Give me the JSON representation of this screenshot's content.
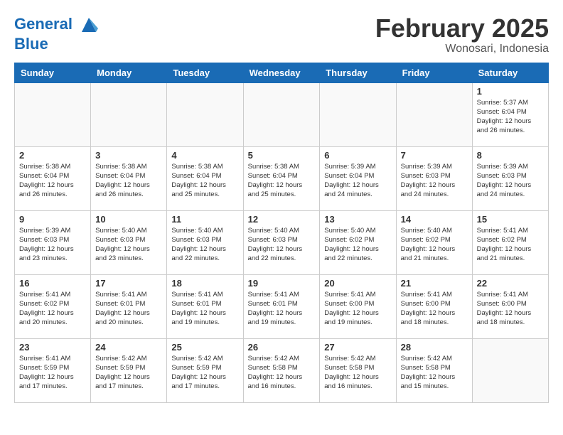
{
  "header": {
    "logo_line1": "General",
    "logo_line2": "Blue",
    "month_title": "February 2025",
    "subtitle": "Wonosari, Indonesia"
  },
  "days_of_week": [
    "Sunday",
    "Monday",
    "Tuesday",
    "Wednesday",
    "Thursday",
    "Friday",
    "Saturday"
  ],
  "weeks": [
    [
      {
        "day": "",
        "info": ""
      },
      {
        "day": "",
        "info": ""
      },
      {
        "day": "",
        "info": ""
      },
      {
        "day": "",
        "info": ""
      },
      {
        "day": "",
        "info": ""
      },
      {
        "day": "",
        "info": ""
      },
      {
        "day": "1",
        "info": "Sunrise: 5:37 AM\nSunset: 6:04 PM\nDaylight: 12 hours\nand 26 minutes."
      }
    ],
    [
      {
        "day": "2",
        "info": "Sunrise: 5:38 AM\nSunset: 6:04 PM\nDaylight: 12 hours\nand 26 minutes."
      },
      {
        "day": "3",
        "info": "Sunrise: 5:38 AM\nSunset: 6:04 PM\nDaylight: 12 hours\nand 26 minutes."
      },
      {
        "day": "4",
        "info": "Sunrise: 5:38 AM\nSunset: 6:04 PM\nDaylight: 12 hours\nand 25 minutes."
      },
      {
        "day": "5",
        "info": "Sunrise: 5:38 AM\nSunset: 6:04 PM\nDaylight: 12 hours\nand 25 minutes."
      },
      {
        "day": "6",
        "info": "Sunrise: 5:39 AM\nSunset: 6:04 PM\nDaylight: 12 hours\nand 24 minutes."
      },
      {
        "day": "7",
        "info": "Sunrise: 5:39 AM\nSunset: 6:03 PM\nDaylight: 12 hours\nand 24 minutes."
      },
      {
        "day": "8",
        "info": "Sunrise: 5:39 AM\nSunset: 6:03 PM\nDaylight: 12 hours\nand 24 minutes."
      }
    ],
    [
      {
        "day": "9",
        "info": "Sunrise: 5:39 AM\nSunset: 6:03 PM\nDaylight: 12 hours\nand 23 minutes."
      },
      {
        "day": "10",
        "info": "Sunrise: 5:40 AM\nSunset: 6:03 PM\nDaylight: 12 hours\nand 23 minutes."
      },
      {
        "day": "11",
        "info": "Sunrise: 5:40 AM\nSunset: 6:03 PM\nDaylight: 12 hours\nand 22 minutes."
      },
      {
        "day": "12",
        "info": "Sunrise: 5:40 AM\nSunset: 6:03 PM\nDaylight: 12 hours\nand 22 minutes."
      },
      {
        "day": "13",
        "info": "Sunrise: 5:40 AM\nSunset: 6:02 PM\nDaylight: 12 hours\nand 22 minutes."
      },
      {
        "day": "14",
        "info": "Sunrise: 5:40 AM\nSunset: 6:02 PM\nDaylight: 12 hours\nand 21 minutes."
      },
      {
        "day": "15",
        "info": "Sunrise: 5:41 AM\nSunset: 6:02 PM\nDaylight: 12 hours\nand 21 minutes."
      }
    ],
    [
      {
        "day": "16",
        "info": "Sunrise: 5:41 AM\nSunset: 6:02 PM\nDaylight: 12 hours\nand 20 minutes."
      },
      {
        "day": "17",
        "info": "Sunrise: 5:41 AM\nSunset: 6:01 PM\nDaylight: 12 hours\nand 20 minutes."
      },
      {
        "day": "18",
        "info": "Sunrise: 5:41 AM\nSunset: 6:01 PM\nDaylight: 12 hours\nand 19 minutes."
      },
      {
        "day": "19",
        "info": "Sunrise: 5:41 AM\nSunset: 6:01 PM\nDaylight: 12 hours\nand 19 minutes."
      },
      {
        "day": "20",
        "info": "Sunrise: 5:41 AM\nSunset: 6:00 PM\nDaylight: 12 hours\nand 19 minutes."
      },
      {
        "day": "21",
        "info": "Sunrise: 5:41 AM\nSunset: 6:00 PM\nDaylight: 12 hours\nand 18 minutes."
      },
      {
        "day": "22",
        "info": "Sunrise: 5:41 AM\nSunset: 6:00 PM\nDaylight: 12 hours\nand 18 minutes."
      }
    ],
    [
      {
        "day": "23",
        "info": "Sunrise: 5:41 AM\nSunset: 5:59 PM\nDaylight: 12 hours\nand 17 minutes."
      },
      {
        "day": "24",
        "info": "Sunrise: 5:42 AM\nSunset: 5:59 PM\nDaylight: 12 hours\nand 17 minutes."
      },
      {
        "day": "25",
        "info": "Sunrise: 5:42 AM\nSunset: 5:59 PM\nDaylight: 12 hours\nand 17 minutes."
      },
      {
        "day": "26",
        "info": "Sunrise: 5:42 AM\nSunset: 5:58 PM\nDaylight: 12 hours\nand 16 minutes."
      },
      {
        "day": "27",
        "info": "Sunrise: 5:42 AM\nSunset: 5:58 PM\nDaylight: 12 hours\nand 16 minutes."
      },
      {
        "day": "28",
        "info": "Sunrise: 5:42 AM\nSunset: 5:58 PM\nDaylight: 12 hours\nand 15 minutes."
      },
      {
        "day": "",
        "info": ""
      }
    ]
  ]
}
